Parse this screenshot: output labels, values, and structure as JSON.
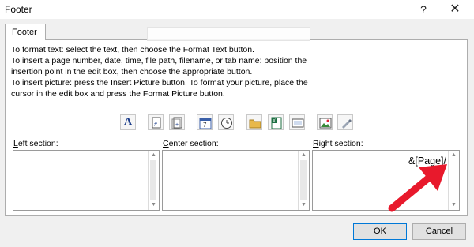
{
  "window": {
    "title": "Footer",
    "help_glyph": "?",
    "close_glyph": "✕"
  },
  "tab": {
    "label": "Footer"
  },
  "instructions": [
    "To format text:  select the text, then choose the Format Text button.",
    "To insert a page number, date, time, file path, filename, or tab name:  position the",
    "     insertion point in the edit box, then choose the appropriate button.",
    "To insert picture: press the Insert Picture button.  To format your picture, place the",
    "     cursor in the edit box and press the Format Picture button."
  ],
  "toolbar": {
    "buttons": [
      {
        "name": "format-text",
        "icon": "letter-a-icon",
        "glyph": "A"
      },
      {
        "name": "insert-page-number",
        "icon": "page-number-icon"
      },
      {
        "name": "insert-number-of-pages",
        "icon": "number-of-pages-icon"
      },
      {
        "name": "insert-date",
        "icon": "calendar-icon",
        "glyph": "7"
      },
      {
        "name": "insert-time",
        "icon": "clock-icon"
      },
      {
        "name": "insert-file-path",
        "icon": "folder-icon"
      },
      {
        "name": "insert-file-name",
        "icon": "excel-file-icon"
      },
      {
        "name": "insert-sheet-name",
        "icon": "sheet-tab-icon"
      },
      {
        "name": "insert-picture",
        "icon": "picture-icon"
      },
      {
        "name": "format-picture",
        "icon": "format-picture-icon"
      }
    ]
  },
  "sections": {
    "left": {
      "label_prefix": "L",
      "label_rest": "eft section:",
      "value": ""
    },
    "center": {
      "label_prefix": "C",
      "label_rest": "enter section:",
      "value": ""
    },
    "right": {
      "label_prefix": "R",
      "label_rest": "ight section:",
      "value": "&[Page]/"
    }
  },
  "buttons": {
    "ok": "OK",
    "cancel": "Cancel"
  },
  "colors": {
    "annotation_arrow": "#e8192c",
    "focus_border": "#0078d7"
  }
}
